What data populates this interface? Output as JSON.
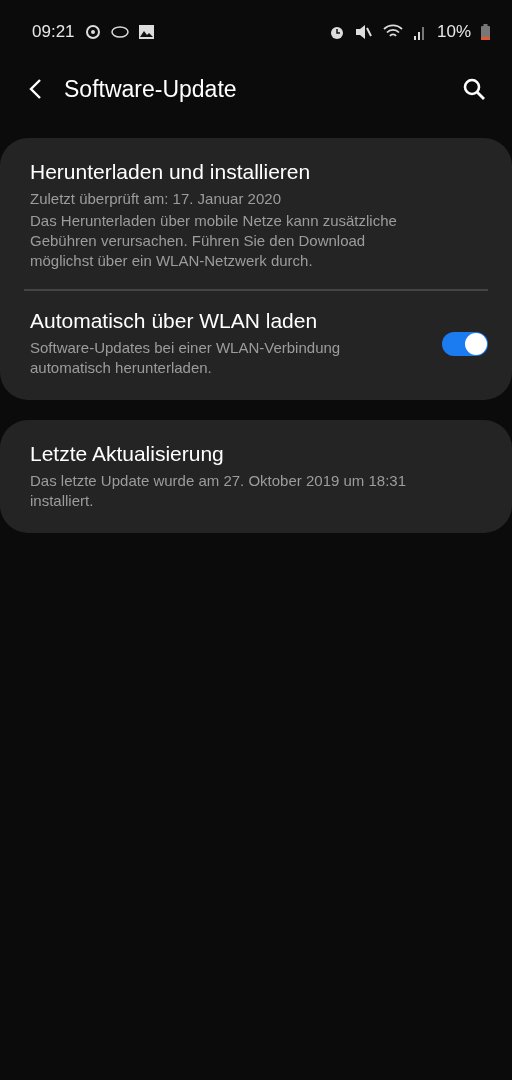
{
  "status_bar": {
    "time": "09:21",
    "battery": "10%"
  },
  "header": {
    "title": "Software-Update"
  },
  "cards": [
    {
      "items": [
        {
          "kind": "info",
          "title": "Herunterladen und installieren",
          "lines": [
            "Zuletzt überprüft am: 17. Januar 2020",
            "Das Herunterladen über mobile Netze kann zusätzliche\nGebühren verursachen. Führen Sie den Download\nmöglichst über ein WLAN-Netzwerk durch."
          ]
        },
        {
          "kind": "switch",
          "title": "Automatisch über WLAN laden",
          "lines": [
            "Software-Updates bei einer WLAN-Verbindung\nautomatisch herunterladen."
          ],
          "on": true
        }
      ]
    },
    {
      "items": [
        {
          "kind": "info",
          "title": "Letzte Aktualisierung",
          "lines": [
            "Das letzte Update wurde am 27. Oktober 2019 um 18:31\ninstalliert."
          ]
        }
      ]
    }
  ]
}
